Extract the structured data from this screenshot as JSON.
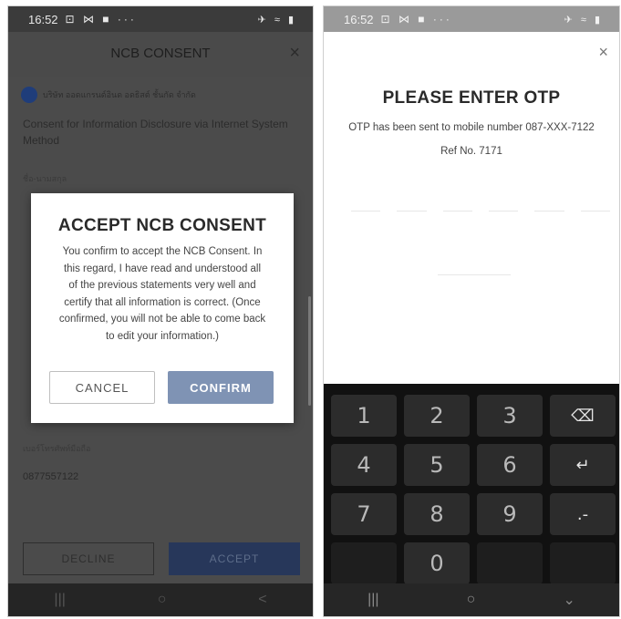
{
  "left": {
    "status": {
      "time": "16:52",
      "left_icons": "⊡ ⋈ ■ ···",
      "right_icons": "✈ ≈ ▮"
    },
    "appbar": {
      "title": "NCB CONSENT",
      "close": "×"
    },
    "logo": {
      "mark": "First",
      "text": "บริษัท ออดแกรนด์อินด อดธิสต์ ชั้นกัด จำกัด"
    },
    "intro": {
      "line1": "Consent for Information Disclosure via Internet System",
      "line2": "Method"
    },
    "fields": {
      "label1": "ชื่อ-นามสกุล",
      "phone_label": "เบอร์โทรศัพท์มือถือ",
      "phone_value": "0877557122"
    },
    "dialog": {
      "title": "ACCEPT NCB CONSENT",
      "message": "You confirm to accept the NCB Consent. In this regard, I have read and understood all of the previous statements very well and certify that all information is correct. (Once confirmed, you will not be able to come back to edit your information.)",
      "cancel": "CANCEL",
      "confirm": "CONFIRM"
    },
    "bottom": {
      "decline": "DECLINE",
      "accept": "ACCEPT"
    },
    "nav": {
      "recent": "|||",
      "home": "○",
      "back": "<"
    }
  },
  "right": {
    "status": {
      "time": "16:52",
      "left_icons": "⊡ ⋈ ■ ···",
      "right_icons": "✈ ≈ ▮"
    },
    "close": "×",
    "title": "PLEASE ENTER OTP",
    "description": "OTP has been sent to mobile number 087-XXX-7122",
    "ref": "Ref No. 7171",
    "keys": [
      "1",
      "2",
      "3",
      "⌫",
      "4",
      "5",
      "6",
      "↵",
      "7",
      "8",
      "9",
      ".-",
      "0"
    ],
    "nav": {
      "recent": "|||",
      "home": "○",
      "hide": "⌄"
    }
  },
  "colors": {
    "confirm": "#7f93b4",
    "accept": "#27375a",
    "overlay": "#4b4b4b",
    "keypad": "#111111"
  }
}
